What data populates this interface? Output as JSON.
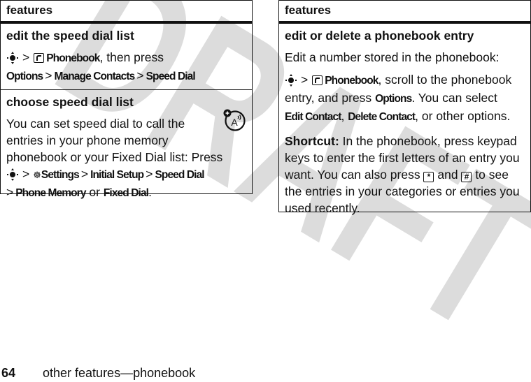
{
  "watermark": "DRAFT",
  "left_table": {
    "header": "features",
    "rows": [
      {
        "title": "edit the speed dial list",
        "path_part1_item": "Phonebook",
        "path_part1_tail": ", then press",
        "path_part2": [
          "Options",
          "Manage Contacts",
          "Speed Dial"
        ]
      },
      {
        "title": "choose speed dial list",
        "text": "You can set speed dial to call the entries in your phone memory phonebook or your Fixed Dial list: Press",
        "path": [
          "Settings",
          "Initial Setup",
          "Speed Dial"
        ],
        "option1": "Phone Memory",
        "or": "or",
        "option2": "Fixed Dial",
        "end": "."
      }
    ]
  },
  "right_table": {
    "header": "features",
    "rows": [
      {
        "title": "edit or delete a phonebook entry",
        "intro": "Edit a number stored in the phonebook:",
        "path_item": "Phonebook",
        "path_tail": ", scroll to the phonebook entry, and press",
        "options_label": "Options",
        "select_text": ". You can select",
        "option1": "Edit Contact",
        "sep": ",",
        "option2": "Delete Contact",
        "tail": ", or other options.",
        "shortcut_label": "Shortcut:",
        "shortcut_text1": "In the phonebook, press keypad keys to enter the first letters of an entry you want. You can also press",
        "key_star": "*",
        "and": "and",
        "key_hash": "#",
        "shortcut_text2": "to see the entries in your categories or entries you used recently."
      }
    ]
  },
  "symbols": {
    "greater_than": ">"
  },
  "footer": {
    "page_number": "64",
    "section_title": "other features—phonebook"
  }
}
